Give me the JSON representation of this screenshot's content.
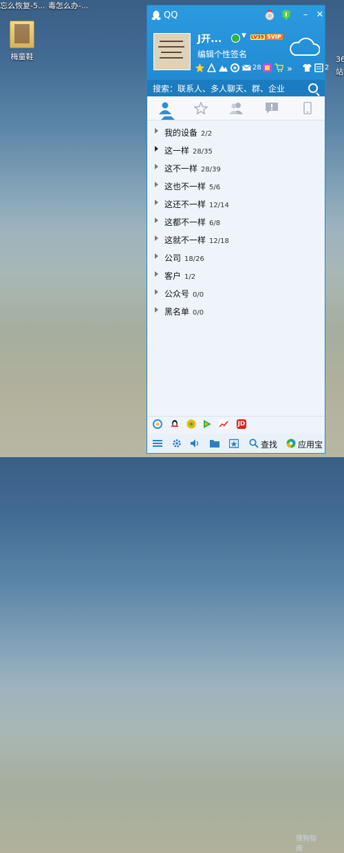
{
  "desktop": {
    "top_texts": [
      "忘么恢复-5...",
      "毒怎么办-..."
    ],
    "icon_label": "梅童鞋",
    "right_texts": [
      "36",
      "站"
    ]
  },
  "window": {
    "title": "QQ",
    "buttons": {
      "minimize": "–",
      "close": "✕"
    }
  },
  "profile": {
    "nickname": "J开...",
    "level_badge": "LV39",
    "svip_badge": "5VIP",
    "signature": "编辑个性签名",
    "mail_count": "28",
    "extra_count": "2",
    "more_glyph": "»"
  },
  "search": {
    "placeholder": "搜索：联系人、多人聊天、群、企业"
  },
  "tabs": [
    "contacts",
    "favorites",
    "groups",
    "messages",
    "phone"
  ],
  "groups": [
    {
      "name": "我的设备",
      "count": "2/2"
    },
    {
      "name": "这一样",
      "count": "28/35"
    },
    {
      "name": "这不一样",
      "count": "28/39"
    },
    {
      "name": "这也不一样",
      "count": "5/6"
    },
    {
      "name": "这还不一样",
      "count": "12/14"
    },
    {
      "name": "这都不一样",
      "count": "6/8"
    },
    {
      "name": "这就不一样",
      "count": "12/18"
    },
    {
      "name": "公司",
      "count": "18/26"
    },
    {
      "name": "客户",
      "count": "1/2"
    },
    {
      "name": "公众号",
      "count": "0/0"
    },
    {
      "name": "黑名单",
      "count": "0/0"
    }
  ],
  "bottom": {
    "find_label": "查找",
    "appstore_label": "应用宝",
    "jd_label": "JD",
    "watermark": "搜狗指南"
  },
  "colors": {
    "accent": "#1f87cf",
    "search_bar": "#1b7cbf",
    "list_bg": "#eef4fa"
  }
}
